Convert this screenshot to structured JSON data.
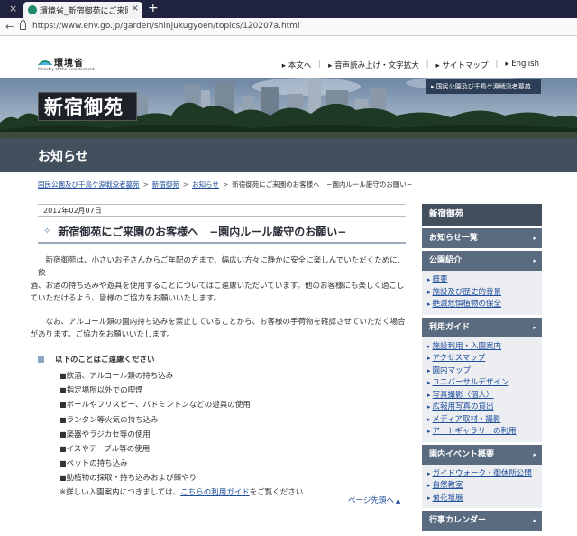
{
  "browser": {
    "tab_title": "環境省_新宿御苑にご来園のお客",
    "new_tab": "+",
    "close": "×",
    "url": "https://www.env.go.jp/garden/shinjukugyoen/topics/120207a.html"
  },
  "header": {
    "logo_text": "環境省",
    "logo_sub": "Ministry of the Environment",
    "nav": [
      "本文へ",
      "音声読み上げ・文字拡大",
      "サイトマップ",
      "English"
    ]
  },
  "hero": {
    "title": "新宿御苑",
    "badge": "国民公園及び千鳥ケ淵戦没者墓苑"
  },
  "section_title": "お知らせ",
  "breadcrumb": {
    "items": [
      "国民公園及び千鳥ケ淵戦没者墓苑",
      "新宿御苑",
      "お知らせ"
    ],
    "current": "新宿御苑にご来園のお客様へ　−園内ルール厳守のお願い−"
  },
  "article": {
    "date": "2012年02月07日",
    "title": "新宿御苑にご来園のお客様へ　−園内ルール厳守のお願い−",
    "para1_line1": "新宿御苑は、小さいお子さんからご年配の方まで、幅広い方々に静かに安全に楽しんでいただくために、飲",
    "para1_line2": "酒、お酒の持ち込みや遊具を使用することについてはご遠慮いただいています。他のお客様にも楽しく過ごし",
    "para1_line3": "ていただけるよう、皆様のご協力をお願いいたします。",
    "para2_line1": "なお、アルコール類の園内持ち込みを禁止していることから、お客様の手荷物を確認させていただく場合",
    "para2_line2": "があります。ご協力をお願いいたします。",
    "subhead": "以下のことはご遠慮ください",
    "rules": [
      "飲酒、アルコール類の持ち込み",
      "指定場所以外での喫煙",
      "ボールやフリスビー、バドミントンなどの遊具の使用",
      "ランタン等火気の持ち込み",
      "楽器やラジカセ等の使用",
      "イスやテーブル等の使用",
      "ペットの持ち込み",
      "動植物の採取・持ち込みおよび餌やり"
    ],
    "note_prefix": "※詳しい入園案内につきましては、",
    "note_link": "こちらの利用ガイド",
    "note_suffix": "をご覧ください",
    "pagetop": "ページ先頭へ"
  },
  "sidebar": {
    "head": "新宿御苑",
    "news": "お知らせ一覧",
    "intro": {
      "label": "公園紹介",
      "items": [
        "概要",
        "施設及び歴史的背景",
        "絶滅危惧植物の保全"
      ]
    },
    "guide": {
      "label": "利用ガイド",
      "items": [
        "施設利用・入園案内",
        "アクセスマップ",
        "園内マップ",
        "ユニバーサルデザイン",
        "写真撮影（個人）",
        "広報用写真の貸出",
        "メディア取材・撮影",
        "アートギャラリーの利用"
      ]
    },
    "events": {
      "label": "園内イベント概要",
      "items": [
        "ガイドウォーク・御休所公開",
        "自然教室",
        "菊花壇展"
      ]
    },
    "calendar": "行事カレンダー"
  }
}
